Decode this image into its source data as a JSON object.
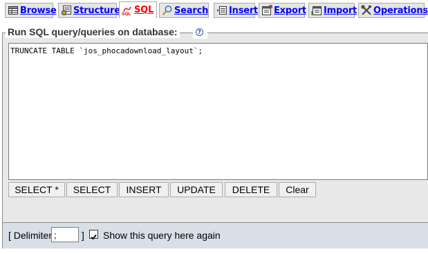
{
  "tabs": [
    {
      "label": "Browse",
      "icon": "table-browse-icon",
      "active": false
    },
    {
      "label": "Structure",
      "icon": "structure-icon",
      "active": false
    },
    {
      "label": "SQL",
      "icon": "sql-icon",
      "active": true
    },
    {
      "label": "Search",
      "icon": "search-icon",
      "active": false
    },
    {
      "label": "Insert",
      "icon": "insert-icon",
      "active": false
    },
    {
      "label": "Export",
      "icon": "export-icon",
      "active": false
    },
    {
      "label": "Import",
      "icon": "import-icon",
      "active": false
    },
    {
      "label": "Operations",
      "icon": "operations-icon",
      "active": false
    }
  ],
  "query_panel": {
    "legend": "Run SQL query/queries on database:",
    "help_glyph": "?",
    "query_text": "TRUNCATE TABLE `jos_phocadownload_layout`;"
  },
  "buttons": {
    "select_star": "SELECT *",
    "select": "SELECT",
    "insert": "INSERT",
    "update": "UPDATE",
    "delete": "DELETE",
    "clear": "Clear"
  },
  "options": {
    "delimiter_label": "[ Delimiter",
    "delimiter_value": ";",
    "delimiter_close": "]",
    "show_query_checked": true,
    "show_query_label": "Show this query here again"
  },
  "colors": {
    "tab_link": "#0000ff",
    "tab_active": "#ff0000",
    "panel_bg": "#e8e8e8",
    "options_bg": "#d8dfe7"
  }
}
